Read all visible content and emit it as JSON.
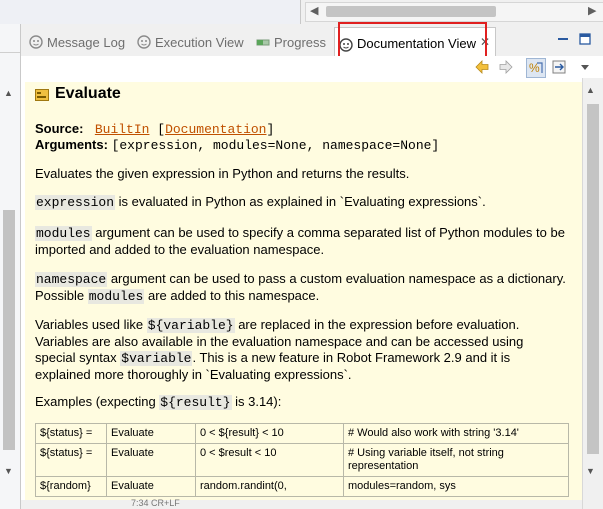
{
  "tabs": [
    {
      "label": "Message Log",
      "active": false
    },
    {
      "label": "Execution View",
      "active": false
    },
    {
      "label": "Progress",
      "active": false
    },
    {
      "label": "Documentation View",
      "active": true
    }
  ],
  "doc": {
    "title": "Evaluate",
    "source_label": "Source:",
    "source_link": "BuiltIn",
    "source_doc_link": "Documentation",
    "arguments_label": "Arguments:",
    "arguments_value": "[expression, modules=None, namespace=None]",
    "p1": "Evaluates the given expression in Python and returns the results.",
    "p2_code": "expression",
    "p2_text": " is evaluated in Python as explained in `Evaluating expressions`.",
    "p3_code": "modules",
    "p3_text": " argument can be used to specify a comma separated list of Python modules to be imported and added to the evaluation namespace.",
    "p4_code": "namespace",
    "p4_text1": " argument can be used to pass a custom evaluation namespace as a dictionary. Possible ",
    "p4_code2": "modules",
    "p4_text2": " are added to this namespace.",
    "p5_text1": "Variables used like ",
    "p5_code1": "${variable}",
    "p5_text2": " are replaced in the expression before evaluation. Variables are also available in the evaluation namespace and can be accessed using special syntax ",
    "p5_code2": "$variable",
    "p5_text3": ". This is a new feature in Robot Framework 2.9 and it is explained more thoroughly in `Evaluating expressions`.",
    "p6_text1": "Examples (expecting ",
    "p6_code": "${result}",
    "p6_text2": " is 3.14):",
    "examples": [
      [
        "${status} =",
        "Evaluate",
        "0 < ${result} < 10",
        "# Would also work with string '3.14'"
      ],
      [
        "${status} =",
        "Evaluate",
        "0 < $result < 10",
        "# Using variable itself, not string representation"
      ],
      [
        "${random}",
        "Evaluate",
        "random.randint(0,",
        "modules=random, sys"
      ]
    ]
  },
  "status": "7:34    CR+LF",
  "colors": {
    "doc_bg": "#fffce0",
    "link": "#c05000",
    "highlight": "#e02020"
  }
}
